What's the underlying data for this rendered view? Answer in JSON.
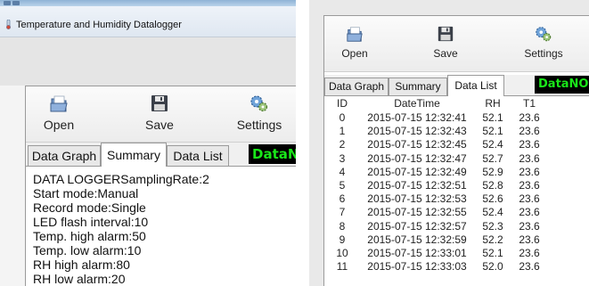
{
  "left": {
    "window_title": "Temperature and Humidity Datalogger",
    "toolbar": {
      "open": "Open",
      "save": "Save",
      "settings": "Settings"
    },
    "tabs": [
      "Data Graph",
      "Summary",
      "Data List"
    ],
    "active_tab": "Summary",
    "datano": "DataN",
    "summary_lines": [
      "DATA LOGGERSamplingRate:2",
      "Start mode:Manual",
      "Record mode:Single",
      "LED flash interval:10",
      "Temp. high alarm:50",
      "Temp. low alarm:10",
      "RH high alarm:80",
      "RH low alarm:20"
    ]
  },
  "right": {
    "toolbar": {
      "open": "Open",
      "save": "Save",
      "settings": "Settings"
    },
    "tabs": [
      "Data Graph",
      "Summary",
      "Data List"
    ],
    "active_tab": "Data List",
    "datano": "DataNO.",
    "columns": [
      "ID",
      "DateTime",
      "RH",
      "T1"
    ],
    "rows": [
      [
        "0",
        "2015-07-15  12:32:41",
        "52.1",
        "23.6"
      ],
      [
        "1",
        "2015-07-15  12:32:43",
        "52.1",
        "23.6"
      ],
      [
        "2",
        "2015-07-15  12:32:45",
        "52.4",
        "23.6"
      ],
      [
        "3",
        "2015-07-15  12:32:47",
        "52.7",
        "23.6"
      ],
      [
        "4",
        "2015-07-15  12:32:49",
        "52.9",
        "23.6"
      ],
      [
        "5",
        "2015-07-15  12:32:51",
        "52.8",
        "23.6"
      ],
      [
        "6",
        "2015-07-15  12:32:53",
        "52.6",
        "23.6"
      ],
      [
        "7",
        "2015-07-15  12:32:55",
        "52.4",
        "23.6"
      ],
      [
        "8",
        "2015-07-15  12:32:57",
        "52.3",
        "23.6"
      ],
      [
        "9",
        "2015-07-15  12:32:59",
        "52.2",
        "23.6"
      ],
      [
        "10",
        "2015-07-15  12:33:01",
        "52.1",
        "23.6"
      ],
      [
        "11",
        "2015-07-15  12:33:03",
        "52.0",
        "23.6"
      ]
    ]
  },
  "colors": {
    "datano_bg": "#000000",
    "datano_text": "#19e619"
  },
  "icons": {
    "open": "open-folder-icon",
    "save": "floppy-disk-icon",
    "settings": "gears-icon"
  }
}
